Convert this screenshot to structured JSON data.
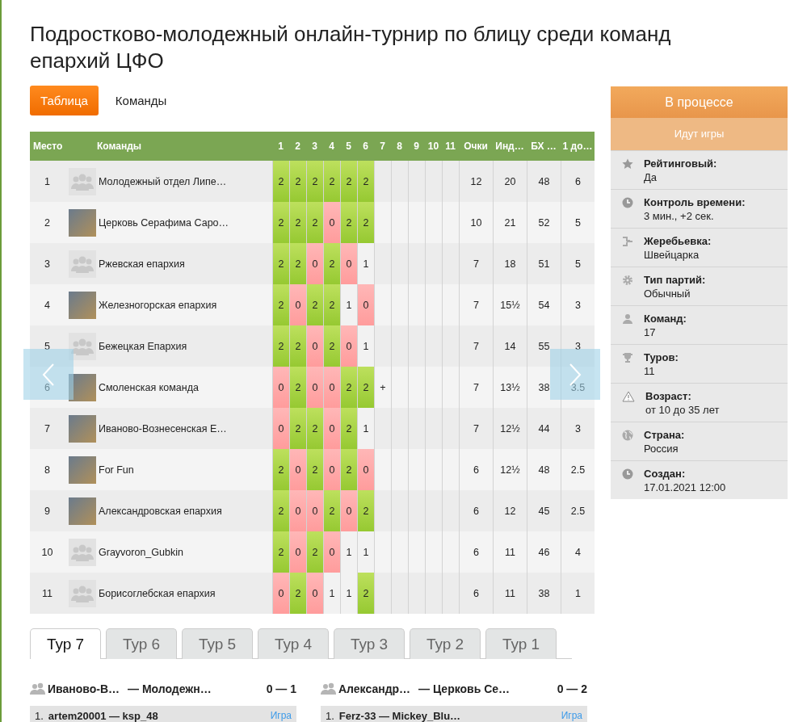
{
  "title": "Подростково-молодежный онлайн-турнир по блицу среди команд епархий ЦФО",
  "view_tabs": [
    {
      "label": "Таблица",
      "selected": true
    },
    {
      "label": "Команды",
      "selected": false
    }
  ],
  "table": {
    "columns": {
      "place": "Место",
      "team": "Команды",
      "rounds": [
        "1",
        "2",
        "3",
        "4",
        "5",
        "6",
        "7",
        "8",
        "9",
        "10",
        "11"
      ],
      "points": "Очки",
      "individual": "Инд…",
      "bh": "БХ …",
      "tiebreak": "1 до…"
    },
    "rows": [
      {
        "place": "1",
        "photo": false,
        "team": "Молодежный отдел Липе…",
        "results": [
          {
            "score": "2",
            "kind": "win"
          },
          {
            "score": "2",
            "kind": "win"
          },
          {
            "score": "2",
            "kind": "win"
          },
          {
            "score": "2",
            "kind": "win"
          },
          {
            "score": "2",
            "kind": "win"
          },
          {
            "score": "2",
            "kind": "win"
          }
        ],
        "points": "12",
        "individual": "20",
        "bh": "48",
        "tiebreak": "6"
      },
      {
        "place": "2",
        "photo": true,
        "team": "Церковь Серафима Саро…",
        "results": [
          {
            "score": "2",
            "kind": "win"
          },
          {
            "score": "2",
            "kind": "win"
          },
          {
            "score": "2",
            "kind": "win"
          },
          {
            "score": "0",
            "kind": "loss"
          },
          {
            "score": "2",
            "kind": "win"
          },
          {
            "score": "2",
            "kind": "win"
          }
        ],
        "points": "10",
        "individual": "21",
        "bh": "52",
        "tiebreak": "5"
      },
      {
        "place": "3",
        "photo": false,
        "team": "Ржевская епархия",
        "results": [
          {
            "score": "2",
            "kind": "win"
          },
          {
            "score": "2",
            "kind": "win"
          },
          {
            "score": "0",
            "kind": "loss"
          },
          {
            "score": "2",
            "kind": "win"
          },
          {
            "score": "0",
            "kind": "loss"
          },
          {
            "score": "1",
            "kind": "draw"
          }
        ],
        "points": "7",
        "individual": "18",
        "bh": "51",
        "tiebreak": "5"
      },
      {
        "place": "4",
        "photo": true,
        "team": "Железногорская епархия",
        "results": [
          {
            "score": "2",
            "kind": "win"
          },
          {
            "score": "0",
            "kind": "loss"
          },
          {
            "score": "2",
            "kind": "win"
          },
          {
            "score": "2",
            "kind": "win"
          },
          {
            "score": "1",
            "kind": "draw"
          },
          {
            "score": "0",
            "kind": "loss"
          }
        ],
        "points": "7",
        "individual": "15½",
        "bh": "54",
        "tiebreak": "3"
      },
      {
        "place": "5",
        "photo": false,
        "team": "Бежецкая Епархия",
        "results": [
          {
            "score": "2",
            "kind": "win"
          },
          {
            "score": "2",
            "kind": "win"
          },
          {
            "score": "0",
            "kind": "loss"
          },
          {
            "score": "2",
            "kind": "win"
          },
          {
            "score": "0",
            "kind": "loss"
          },
          {
            "score": "1",
            "kind": "draw"
          }
        ],
        "points": "7",
        "individual": "14",
        "bh": "55",
        "tiebreak": "3"
      },
      {
        "place": "6",
        "photo": true,
        "team": "Смоленская команда",
        "results": [
          {
            "score": "0",
            "kind": "loss"
          },
          {
            "score": "2",
            "kind": "win"
          },
          {
            "score": "0",
            "kind": "loss"
          },
          {
            "score": "0",
            "kind": "loss"
          },
          {
            "score": "2",
            "kind": "win"
          },
          {
            "score": "2",
            "kind": "win"
          },
          {
            "score": "+",
            "kind": "pending"
          }
        ],
        "points": "7",
        "individual": "13½",
        "bh": "38",
        "tiebreak": "3.5"
      },
      {
        "place": "7",
        "photo": true,
        "team": "Иваново-Вознесенская Е…",
        "results": [
          {
            "score": "0",
            "kind": "loss"
          },
          {
            "score": "2",
            "kind": "win"
          },
          {
            "score": "2",
            "kind": "win"
          },
          {
            "score": "0",
            "kind": "loss"
          },
          {
            "score": "2",
            "kind": "win"
          },
          {
            "score": "1",
            "kind": "draw"
          }
        ],
        "points": "7",
        "individual": "12½",
        "bh": "44",
        "tiebreak": "3"
      },
      {
        "place": "8",
        "photo": true,
        "team": "For Fun",
        "results": [
          {
            "score": "2",
            "kind": "win"
          },
          {
            "score": "0",
            "kind": "loss"
          },
          {
            "score": "2",
            "kind": "win"
          },
          {
            "score": "0",
            "kind": "loss"
          },
          {
            "score": "2",
            "kind": "win"
          },
          {
            "score": "0",
            "kind": "loss"
          }
        ],
        "points": "6",
        "individual": "12½",
        "bh": "48",
        "tiebreak": "2.5"
      },
      {
        "place": "9",
        "photo": true,
        "team": "Александровская епархия",
        "results": [
          {
            "score": "2",
            "kind": "win"
          },
          {
            "score": "0",
            "kind": "loss"
          },
          {
            "score": "0",
            "kind": "loss"
          },
          {
            "score": "2",
            "kind": "win"
          },
          {
            "score": "0",
            "kind": "loss"
          },
          {
            "score": "2",
            "kind": "win"
          }
        ],
        "points": "6",
        "individual": "12",
        "bh": "45",
        "tiebreak": "2.5"
      },
      {
        "place": "10",
        "photo": false,
        "team": "Grayvoron_Gubkin",
        "results": [
          {
            "score": "2",
            "kind": "win"
          },
          {
            "score": "0",
            "kind": "loss"
          },
          {
            "score": "2",
            "kind": "win"
          },
          {
            "score": "0",
            "kind": "loss"
          },
          {
            "score": "1",
            "kind": "draw"
          },
          {
            "score": "1",
            "kind": "draw"
          }
        ],
        "points": "6",
        "individual": "11",
        "bh": "46",
        "tiebreak": "4"
      },
      {
        "place": "11",
        "photo": false,
        "team": "Борисоглебская епархия",
        "results": [
          {
            "score": "0",
            "kind": "loss"
          },
          {
            "score": "2",
            "kind": "win"
          },
          {
            "score": "0",
            "kind": "loss"
          },
          {
            "score": "1",
            "kind": "draw"
          },
          {
            "score": "1",
            "kind": "draw"
          },
          {
            "score": "2",
            "kind": "win"
          }
        ],
        "points": "6",
        "individual": "11",
        "bh": "38",
        "tiebreak": "1"
      }
    ]
  },
  "round_tabs": [
    {
      "label": "Тур 7",
      "selected": true
    },
    {
      "label": "Тур 6",
      "selected": false
    },
    {
      "label": "Тур 5",
      "selected": false
    },
    {
      "label": "Тур 4",
      "selected": false
    },
    {
      "label": "Тур 3",
      "selected": false
    },
    {
      "label": "Тур 2",
      "selected": false
    },
    {
      "label": "Тур 1",
      "selected": false
    }
  ],
  "matches": [
    {
      "team_a": "Иваново-В…",
      "team_b": "— Молодежн…",
      "score": "0 — 1",
      "games": [
        {
          "number": "1.",
          "players": "artem20001 — ksp_48",
          "link": "Игра"
        }
      ]
    },
    {
      "team_a": "Александр…",
      "team_b": "— Церковь Се…",
      "score": "0 — 2",
      "games": [
        {
          "number": "1.",
          "players": "Ferz-33 — Mickey_Blu…",
          "link": "Игра"
        }
      ]
    }
  ],
  "status": {
    "title": "В процессе",
    "subtitle": "Идут игры"
  },
  "info": [
    {
      "label": "Рейтинговый:",
      "value": "Да"
    },
    {
      "label": "Контроль времени:",
      "value": "3 мин., +2 сек."
    },
    {
      "label": "Жеребьевка:",
      "value": "Швейцарка"
    },
    {
      "label": "Тип партий:",
      "value": "Обычный"
    },
    {
      "label": "Команд:",
      "value": "17"
    },
    {
      "label": "Туров:",
      "value": "11"
    },
    {
      "label": "Возраст:",
      "value": "от 10 до 35 лет"
    },
    {
      "label": "Страна:",
      "value": "Россия"
    },
    {
      "label": "Создан:",
      "value": "17.01.2021 12:00"
    }
  ]
}
